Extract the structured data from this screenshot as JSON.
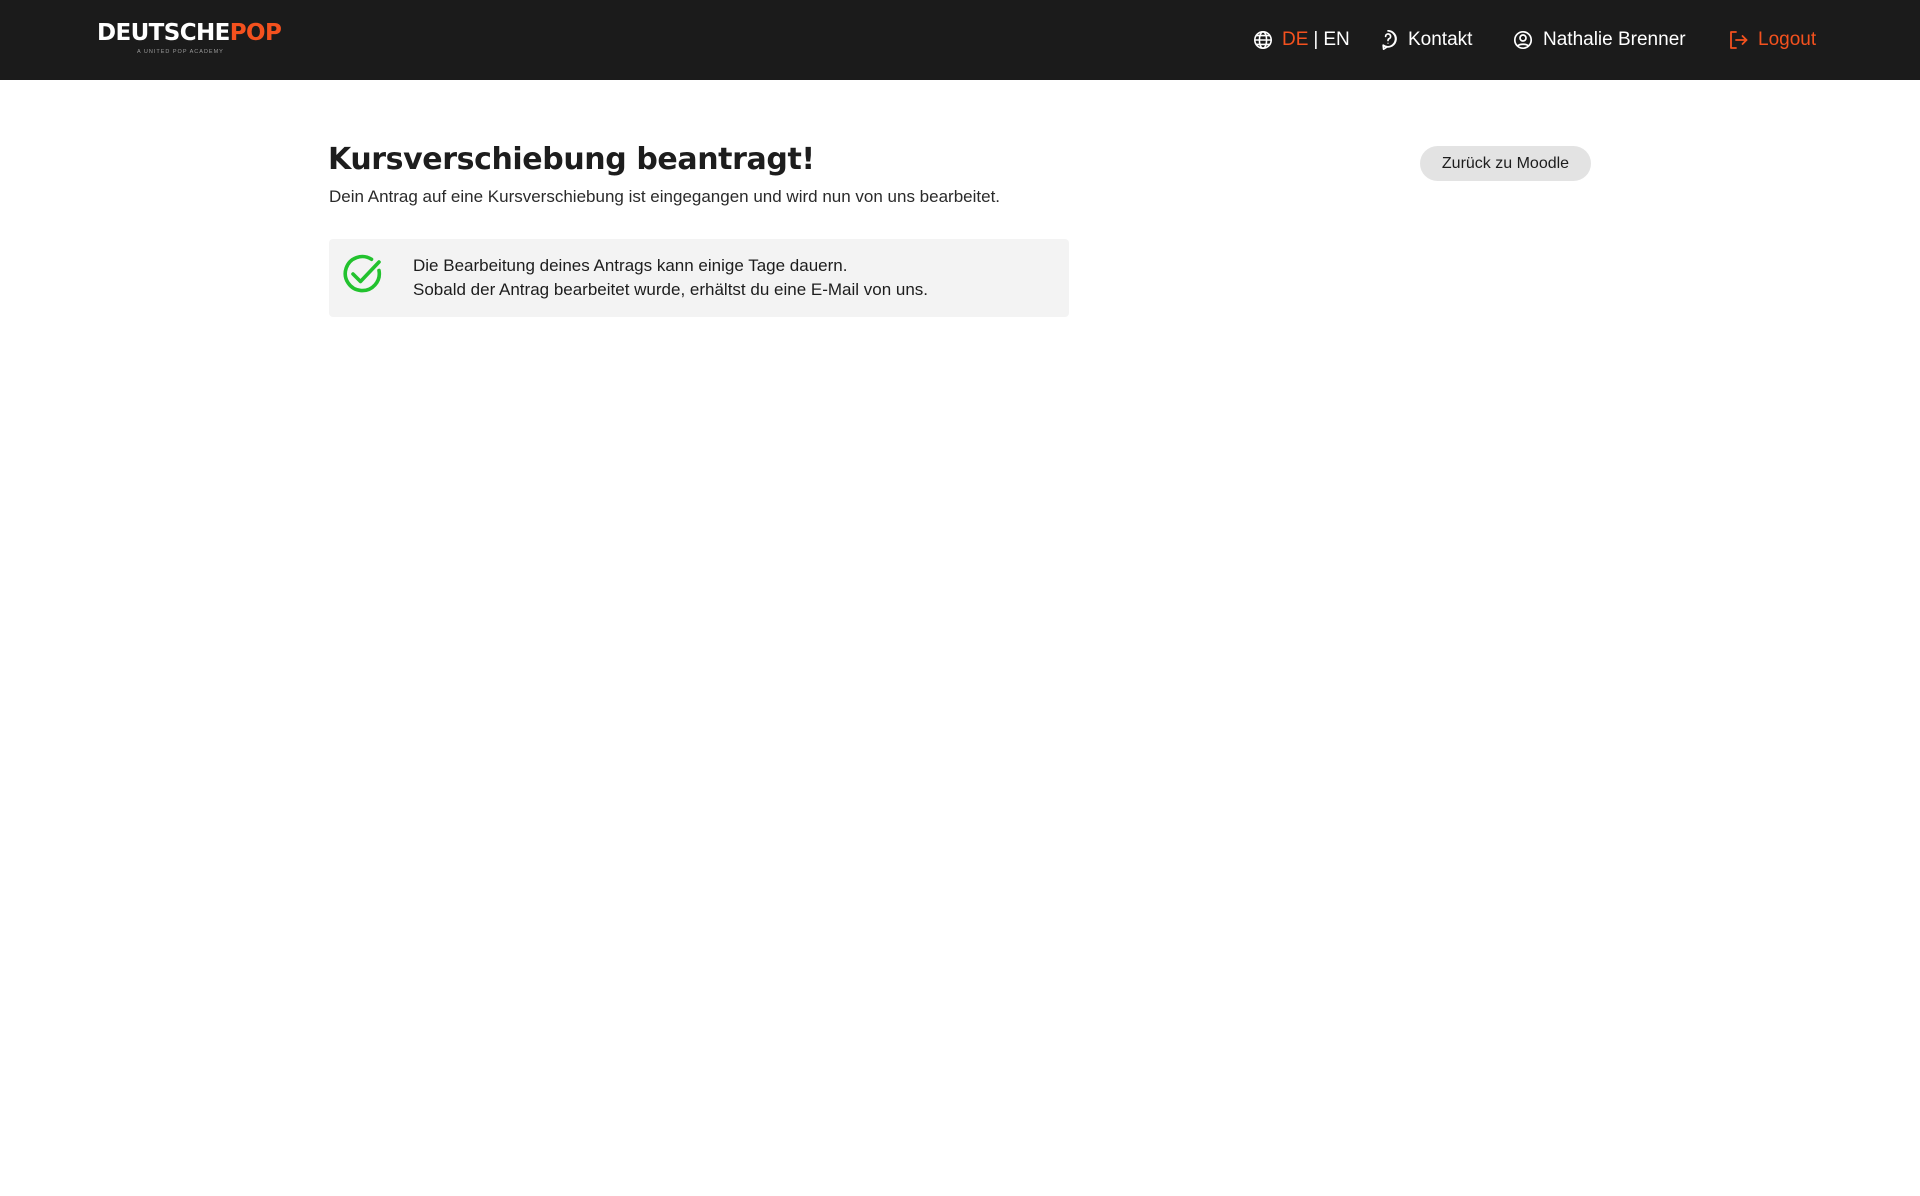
{
  "header": {
    "logo": {
      "part1": "DEUTSCHE",
      "part2": "POP",
      "tagline": "A UNITED POP ACADEMY"
    },
    "language": {
      "icon": "globe-icon",
      "active": "DE",
      "separator": "|",
      "inactive": "EN"
    },
    "contact": {
      "icon": "question-circle-icon",
      "label": "Kontakt"
    },
    "user": {
      "icon": "user-circle-icon",
      "label": "Nathalie Brenner"
    },
    "logout": {
      "icon": "logout-icon",
      "label": "Logout"
    }
  },
  "main": {
    "title": "Kursverschiebung beantragt!",
    "subtitle": "Dein Antrag auf eine Kursverschiebung ist eingegangen und wird nun von uns bearbeitet.",
    "back_button": "Zurück zu Moodle",
    "info": {
      "icon": "check-circle-icon",
      "line1": "Die Bearbeitung deines Antrags kann einige Tage dauern.",
      "line2": "Sobald der Antrag bearbeitet wurde, erhältst du eine E-Mail von uns."
    }
  },
  "colors": {
    "header_bg": "#1b1b1b",
    "accent": "#f4511e",
    "success": "#22c22e",
    "info_bg": "#f3f3f3",
    "button_bg": "#e3e3e3"
  }
}
